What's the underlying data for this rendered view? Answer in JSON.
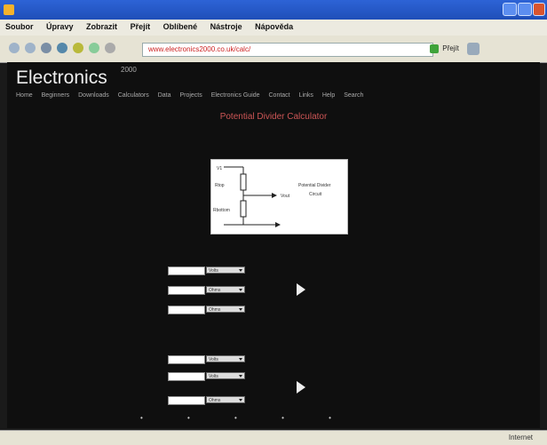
{
  "window": {
    "title": "",
    "buttons": [
      {
        "name": "minimize-button"
      },
      {
        "name": "maximize-button"
      },
      {
        "name": "close-button"
      }
    ]
  },
  "menu": [
    "Soubor",
    "Úpravy",
    "Zobrazit",
    "Přejít",
    "Oblíbené",
    "Nástroje",
    "Nápověda"
  ],
  "toolbar": {
    "address": "www.electronics2000.co.uk/calc/",
    "go_label": "Přejít"
  },
  "header": {
    "brand": "Electronics",
    "brand_sup": "2000",
    "nav": [
      "Home",
      "Beginners",
      "Downloads",
      "Calculators",
      "Data",
      "Projects",
      "Electronics Guide",
      "Contact",
      "Links",
      "Help",
      "Search"
    ]
  },
  "main": {
    "title": "Potential Divider Calculator",
    "intro": "",
    "diagram": {
      "label_left_top": "V1",
      "label_left_mid": "Rtop",
      "label_left_bot": "Rbottom",
      "label_out": "Vout",
      "side_note_1": "Potential Divider",
      "side_note_2": "Circuit"
    },
    "sections": [
      {
        "label": "",
        "rows": [
          {
            "label": "",
            "unit": "Volts"
          },
          {
            "label": "",
            "unit": "Ohms"
          },
          {
            "label": "",
            "unit": "Ohms"
          }
        ],
        "results": [
          "",
          ""
        ]
      },
      {
        "label": "",
        "rows": [
          {
            "label": "",
            "unit": "Volts"
          },
          {
            "label": "",
            "unit": "Volts"
          },
          {
            "label": "",
            "unit": "Ohms"
          }
        ],
        "results": [
          "",
          "",
          "",
          ""
        ]
      }
    ]
  },
  "status": {
    "text": "",
    "zone": "Internet"
  },
  "icons": {
    "app": "app-icon",
    "back": "back-icon",
    "forward": "forward-icon",
    "go": "go-icon",
    "play": "play-arrow-icon"
  }
}
